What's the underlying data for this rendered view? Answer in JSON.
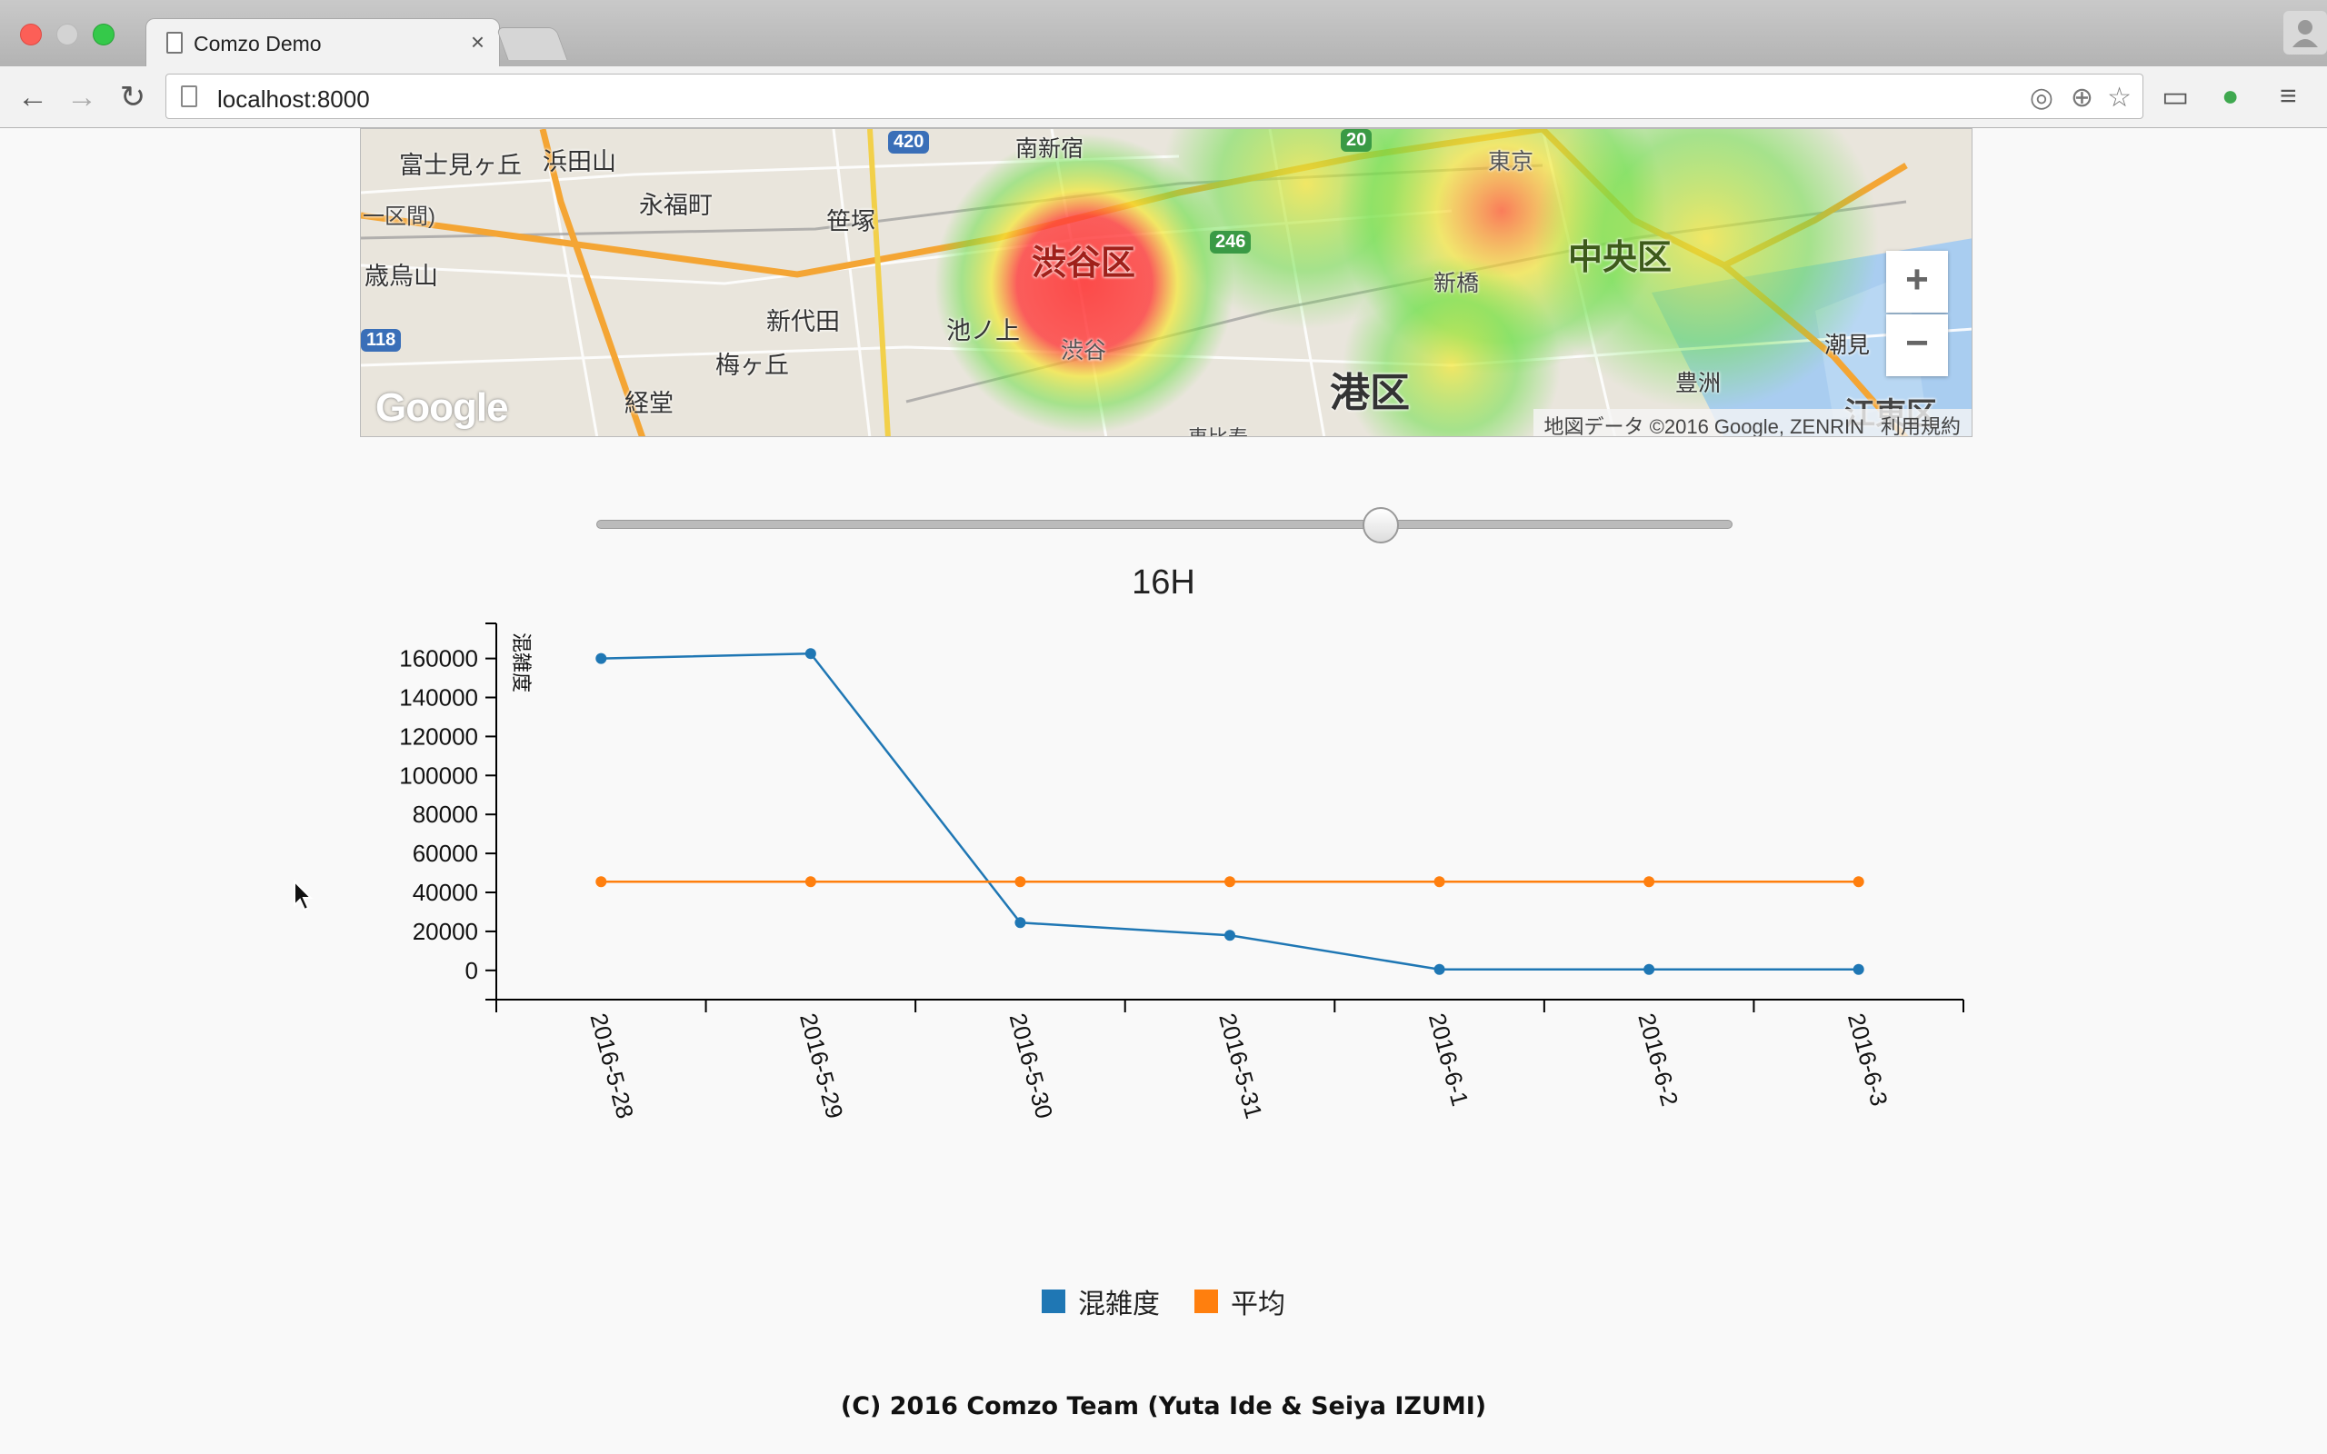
{
  "browser": {
    "tab_title": "Comzo Demo",
    "tab_close": "×",
    "url": "localhost:8000"
  },
  "map": {
    "attribution": "地図データ ©2016 Google, ZENRIN",
    "terms": "利用規約",
    "zoom_in": "+",
    "zoom_out": "−",
    "logo": "Google",
    "labels": [
      {
        "text": "富士見ヶ丘",
        "name": "map-label-fujimigaoka"
      },
      {
        "text": "浜田山",
        "name": "map-label-hamadayama"
      },
      {
        "text": "永福町",
        "name": "map-label-eifukucho"
      },
      {
        "text": "笹塚",
        "name": "map-label-sasazuka"
      },
      {
        "text": "南新宿",
        "name": "map-label-minamishinjuku"
      },
      {
        "text": "歳烏山",
        "name": "map-label-chitosekarasuyama"
      },
      {
        "text": "新代田",
        "name": "map-label-shindaita"
      },
      {
        "text": "池ノ上",
        "name": "map-label-ikenoue"
      },
      {
        "text": "梅ヶ丘",
        "name": "map-label-umegaoka"
      },
      {
        "text": "経堂",
        "name": "map-label-kyodo"
      },
      {
        "text": "渋谷区",
        "name": "map-label-shibuya-ku"
      },
      {
        "text": "渋谷",
        "name": "map-label-shibuya"
      },
      {
        "text": "港区",
        "name": "map-label-minato-ku"
      },
      {
        "text": "新橋",
        "name": "map-label-shinbashi"
      },
      {
        "text": "中央区",
        "name": "map-label-chuo-ku"
      },
      {
        "text": "東京",
        "name": "map-label-tokyo"
      },
      {
        "text": "豊洲",
        "name": "map-label-toyosu"
      },
      {
        "text": "潮見",
        "name": "map-label-shiomi"
      },
      {
        "text": "江東区",
        "name": "map-label-koto-ku"
      },
      {
        "text": "一区間)",
        "name": "map-label-kukan"
      },
      {
        "text": "恵比寿",
        "name": "map-label-ebisu"
      }
    ],
    "route_shields": [
      "420",
      "246",
      "20",
      "118"
    ]
  },
  "slider": {
    "value_fraction": 0.69,
    "hour_label": "16H"
  },
  "chart_data": {
    "type": "line",
    "categories": [
      "2016-5-28",
      "2016-5-29",
      "2016-5-30",
      "2016-5-31",
      "2016-6-1",
      "2016-6-2",
      "2016-6-3"
    ],
    "series": [
      {
        "name": "混雑度",
        "color": "#1f77b4",
        "values": [
          160000,
          162500,
          24500,
          18000,
          500,
          500,
          500
        ]
      },
      {
        "name": "平均",
        "color": "#ff7f0e",
        "values": [
          45500,
          45500,
          45500,
          45500,
          45500,
          45500,
          45500
        ]
      }
    ],
    "ylabel": "混雑度",
    "yticks": [
      "0",
      "20000",
      "40000",
      "60000",
      "80000",
      "100000",
      "120000",
      "140000",
      "160000"
    ],
    "ylim": [
      -15000,
      178000
    ],
    "legend_position": "bottom"
  },
  "footer": "(C) 2016 Comzo Team (Yuta Ide & Seiya IZUMI)",
  "colors": {
    "heat_red": "#ff3b3b",
    "heat_yellow": "#f5f032",
    "heat_green": "#6ee04a"
  }
}
